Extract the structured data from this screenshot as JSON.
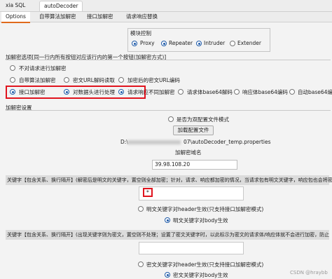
{
  "top_tabs": [
    "xia SQL",
    "autoDecoder"
  ],
  "sub_tabs": [
    "Options",
    "自带算法加解密",
    "接口加解密",
    "请求响应替换"
  ],
  "mode_group": {
    "title": "模块控制",
    "options": [
      "Proxy",
      "Repeater",
      "Intruder",
      "Extender"
    ]
  },
  "decrypt_options": {
    "title": "加解密选项[同一行内所有按钮对应该行内的第一个按钮(加解密方式)]",
    "row1": [
      "不对请求进行加解密"
    ],
    "row2": [
      "自带算法加解密",
      "密文URL解码读取",
      "加密后的密文URL编码"
    ],
    "row3": [
      "接口加解密",
      "对数据头进行处理",
      "请求响应不同加解密",
      "请求体base64解码",
      "响应体base64编码",
      "自动base64编"
    ]
  },
  "settings": {
    "title": "加解密设置",
    "dual_config": "是否为双配置文件模式",
    "load_button": "加载配置文件",
    "path_prefix": "D:\\",
    "path_suffix": "07\\autoDecoder_temp.properties",
    "domain_label": "加解密域名",
    "domain_value": "39.98.108.20",
    "keyword_row": "关键字【包含关系、换行隔开】(解密后是明文的关键字，置空则全部加密；针对，请求、响应都加密的情况，当请求包有明文关键字，响应包也会将密文",
    "keyword_value": "*",
    "header_option": "明文关键字对header生效(只支持接口加解密模式)",
    "body_option": "明文关键字对body生效",
    "cipher_row": "关键字【包含关系、换行隔开】(出现关键字则为密文，置空则不处理；设置了密文关键字时，以此标示为密文的请求体/响应体就不会进行加密，防止",
    "cipher_header_option": "密文关键字对header生效(只支持接口加解密模式)",
    "cipher_body_option": "密文关键字对body生效"
  },
  "watermark": "CSDN @hraybb"
}
